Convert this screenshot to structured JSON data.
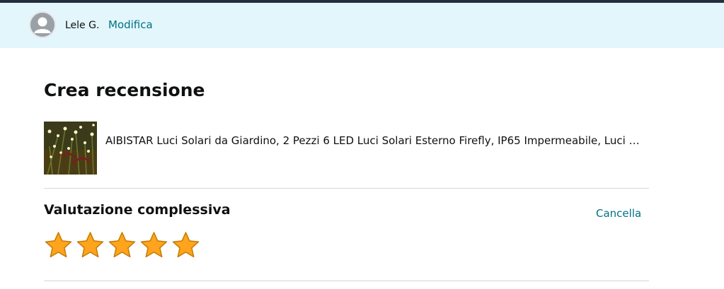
{
  "user": {
    "name": "Lele G.",
    "edit_label": "Modifica",
    "avatar_icon": "user-silhouette-icon"
  },
  "page": {
    "title": "Crea recensione"
  },
  "product": {
    "title": "AIBISTAR Luci Solari da Giardino, 2 Pezzi 6 LED Luci Solari Esterno Firefly, IP65 Impermeabile, Luci Solari per Giardino Decorazioni"
  },
  "rating": {
    "heading": "Valutazione complessiva",
    "clear_label": "Cancella",
    "selected": 5,
    "max": 5,
    "star_color": "#ffa41c"
  },
  "colors": {
    "header_bg": "#e3f6fb",
    "link": "#007185",
    "top_line": "#232f3e"
  }
}
